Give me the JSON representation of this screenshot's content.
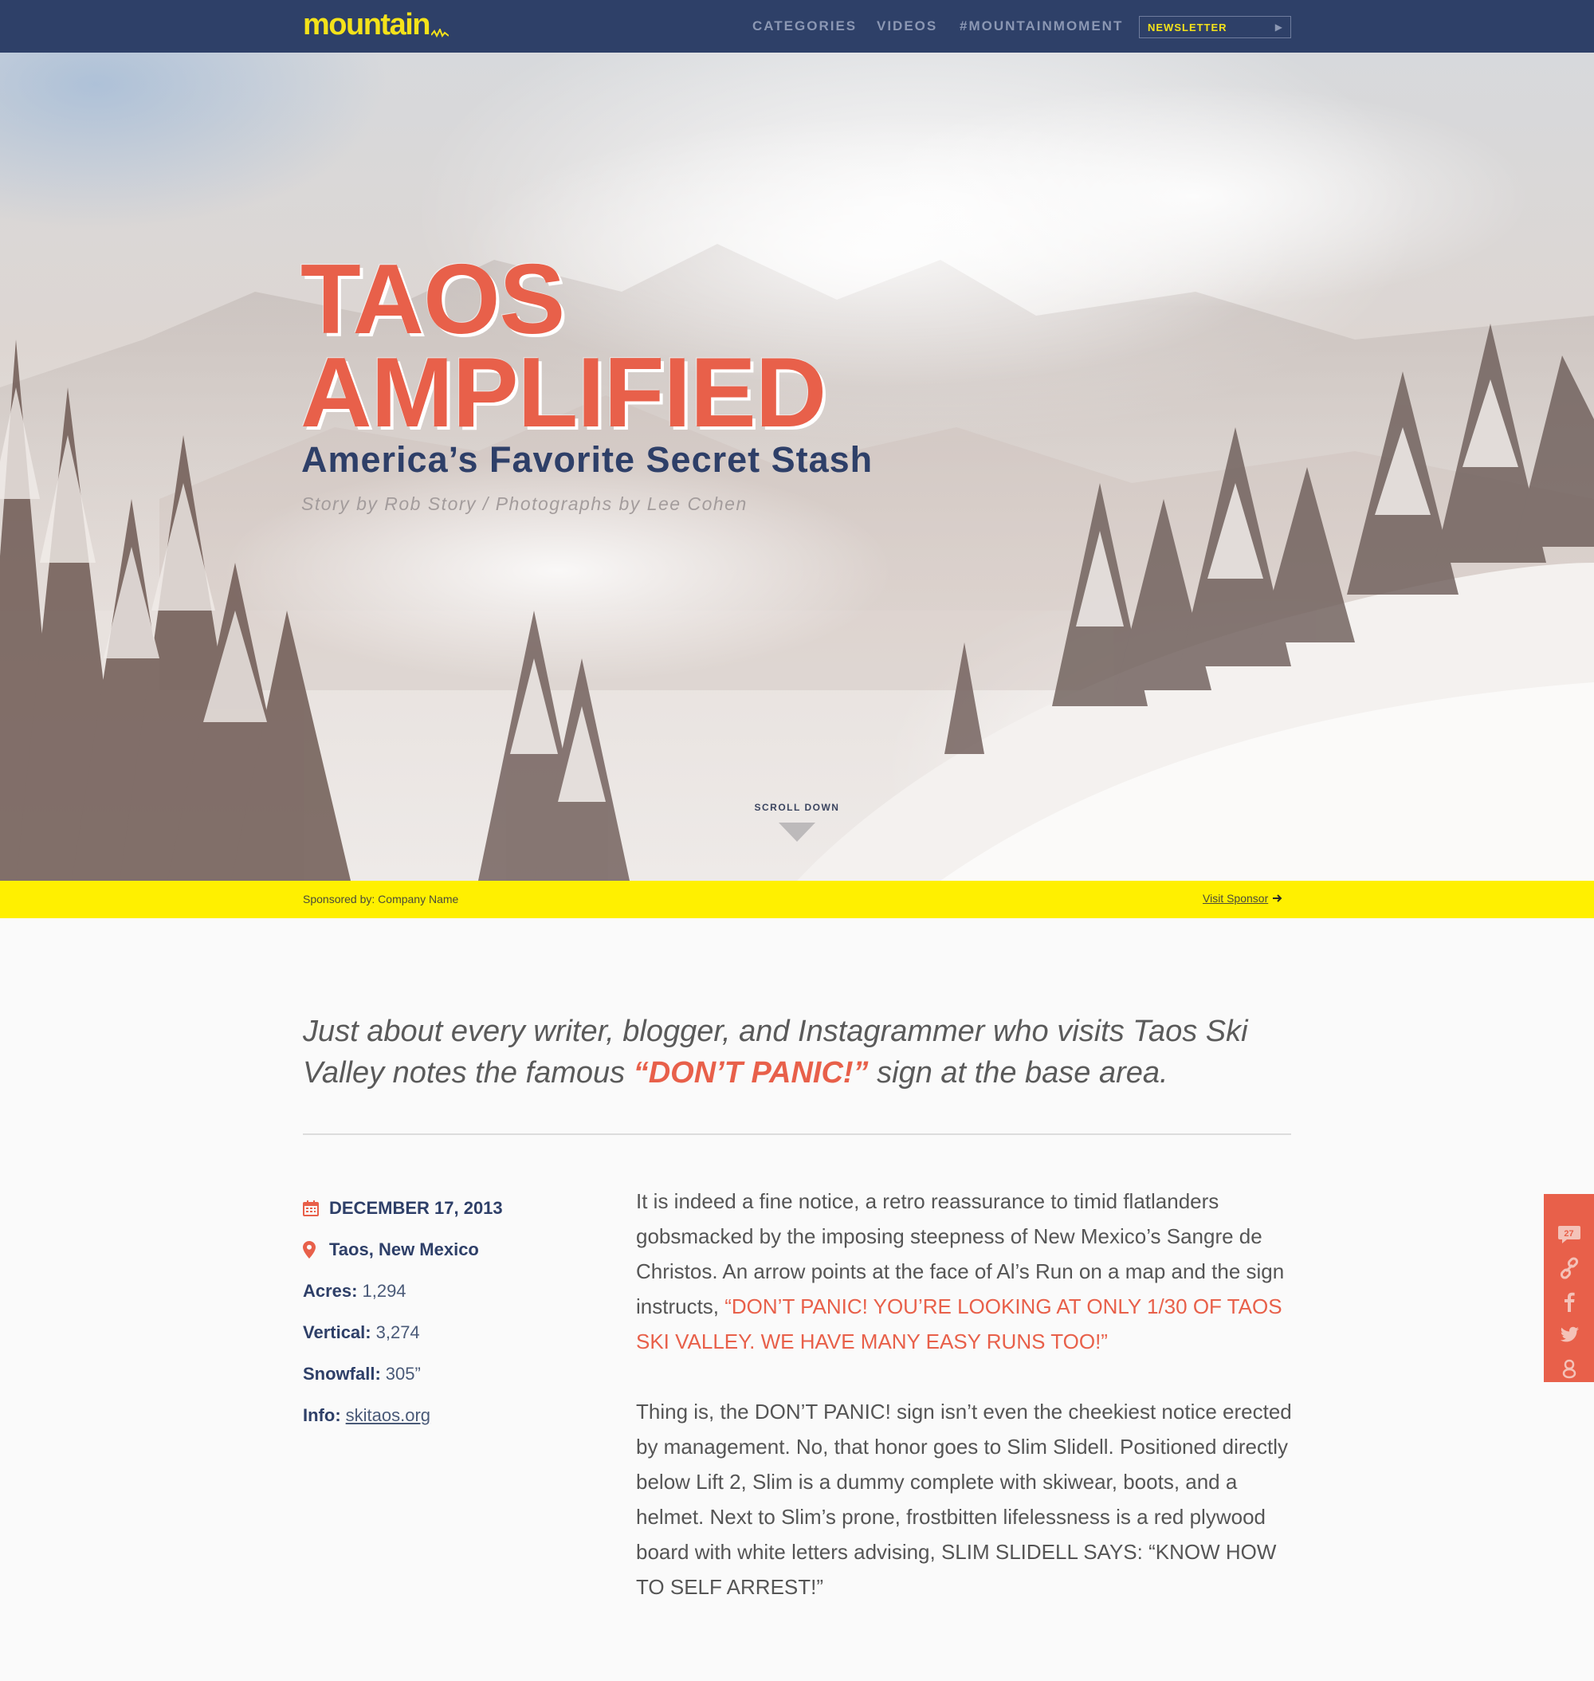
{
  "nav": {
    "logo": "mountain",
    "links": [
      "CATEGORIES",
      "VIDEOS",
      "#MOUNTAINMOMENT"
    ],
    "newsletter_label": "NEWSLETTER"
  },
  "hero": {
    "title_line1": "TAOS",
    "title_line2": "AMPLIFIED",
    "subtitle": "America’s Favorite Secret Stash",
    "byline": "Story by Rob Story / Photographs by Lee Cohen",
    "scroll_label": "SCROLL DOWN"
  },
  "sponsor": {
    "text": "Sponsored by: Company Name",
    "visit_label": "Visit Sponsor"
  },
  "lead": {
    "before": "Just about every writer, blogger, and Instagrammer who visits Taos Ski Valley notes the famous ",
    "accent": "“DON’T PANIC!”",
    "after": " sign at the base area."
  },
  "meta": {
    "date": "DECEMBER 17, 2013",
    "location": "Taos, New Mexico",
    "acres_label": "Acres:",
    "acres_value": "1,294",
    "vertical_label": "Vertical:",
    "vertical_value": "3,274",
    "snowfall_label": "Snowfall:",
    "snowfall_value": "305”",
    "info_label": "Info:",
    "info_link": "skitaos.org"
  },
  "article": {
    "p1_text": "It is indeed a fine notice, a retro reassurance to timid flatlanders gobsmacked by the imposing steepness of New Mexico’s Sangre de Christos. An arrow points at the face of Al’s Run on a map and the sign instructs, ",
    "p1_quote": "“DON’T PANIC! YOU’RE LOOKING AT ONLY 1/30 OF TAOS SKI VALLEY. WE HAVE MANY EASY RUNS TOO!”",
    "p2": "Thing is, the DON’T PANIC! sign isn’t even the cheekiest notice erected by management. No, that honor goes to Slim Slidell. Positioned directly below Lift 2, Slim is a dummy complete with skiwear, boots, and a helmet. Next to Slim’s prone, frostbitten lifelessness is a red plywood board with white letters advising, SLIM SLIDELL SAYS: “KNOW HOW TO SELF ARREST!”"
  },
  "share": {
    "comment_count": "27",
    "icons": [
      "comment-icon",
      "link-icon",
      "facebook-icon",
      "twitter-icon",
      "google-plus-icon"
    ]
  },
  "colors": {
    "nav_bg": "#2e4068",
    "logo_yellow": "#f4e21a",
    "accent_coral": "#e8604a",
    "navy": "#2e3f68",
    "sponsor_yellow": "#fff000"
  }
}
